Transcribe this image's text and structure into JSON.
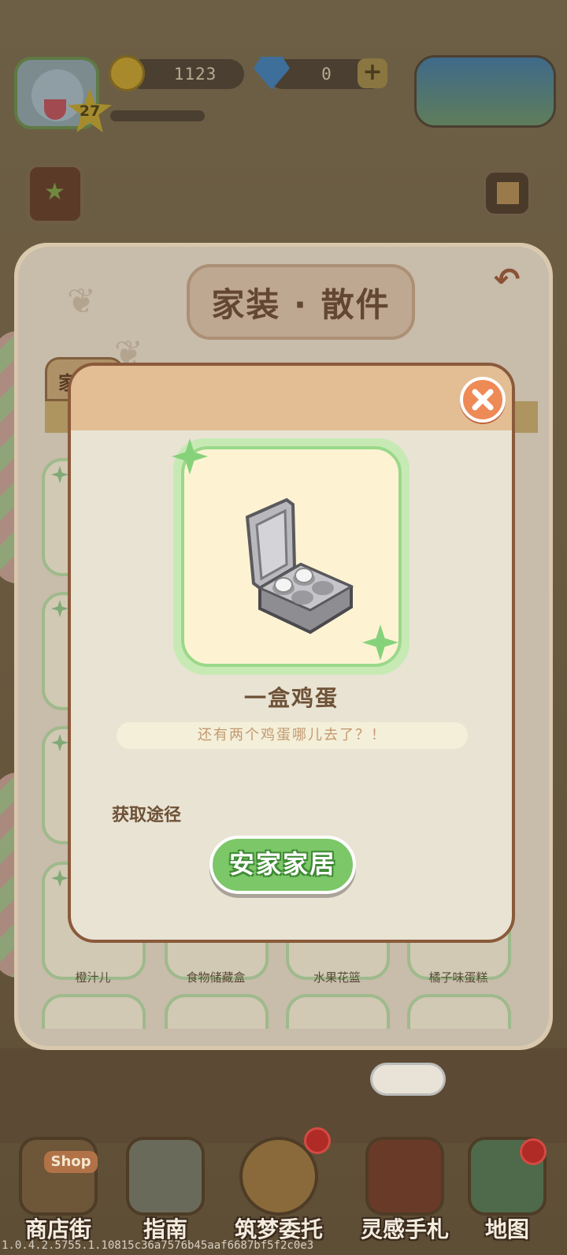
{
  "hud": {
    "level": "27",
    "coins": "1123",
    "gems": "0",
    "plus": "+"
  },
  "panel": {
    "title": "家装 · 散件",
    "first_tab_label": "家",
    "back_icon": "undo-arrow-icon",
    "grid_labels": [
      "橙汁儿",
      "食物储藏盒",
      "水果花篮",
      "橘子味蛋糕"
    ]
  },
  "modal": {
    "item_name": "一盒鸡蛋",
    "item_description": "还有两个鸡蛋哪儿去了？！",
    "source_label": "获取途径",
    "source_button": "安家家居",
    "close_icon": "close-x-icon"
  },
  "bottom_nav": {
    "items": [
      {
        "label": "商店街",
        "icon": "shop-icon",
        "sign": "Shop"
      },
      {
        "label": "指南",
        "icon": "guide-book-icon"
      },
      {
        "label": "筑梦委托",
        "icon": "commission-backpack-icon"
      },
      {
        "label": "灵感手札",
        "icon": "inspiration-notebook-icon"
      },
      {
        "label": "地图",
        "icon": "map-icon"
      }
    ]
  },
  "footer": {
    "version": "1.0.4.2.5755.1.10815c36a7576b45aaf6687bf5f2c0e3"
  },
  "colors": {
    "modal_header": "#e3bd93",
    "modal_body": "#e9e3d4",
    "close_button": "#ee8a56",
    "source_button": "#7cc768",
    "item_frame": "#9bd88a"
  }
}
